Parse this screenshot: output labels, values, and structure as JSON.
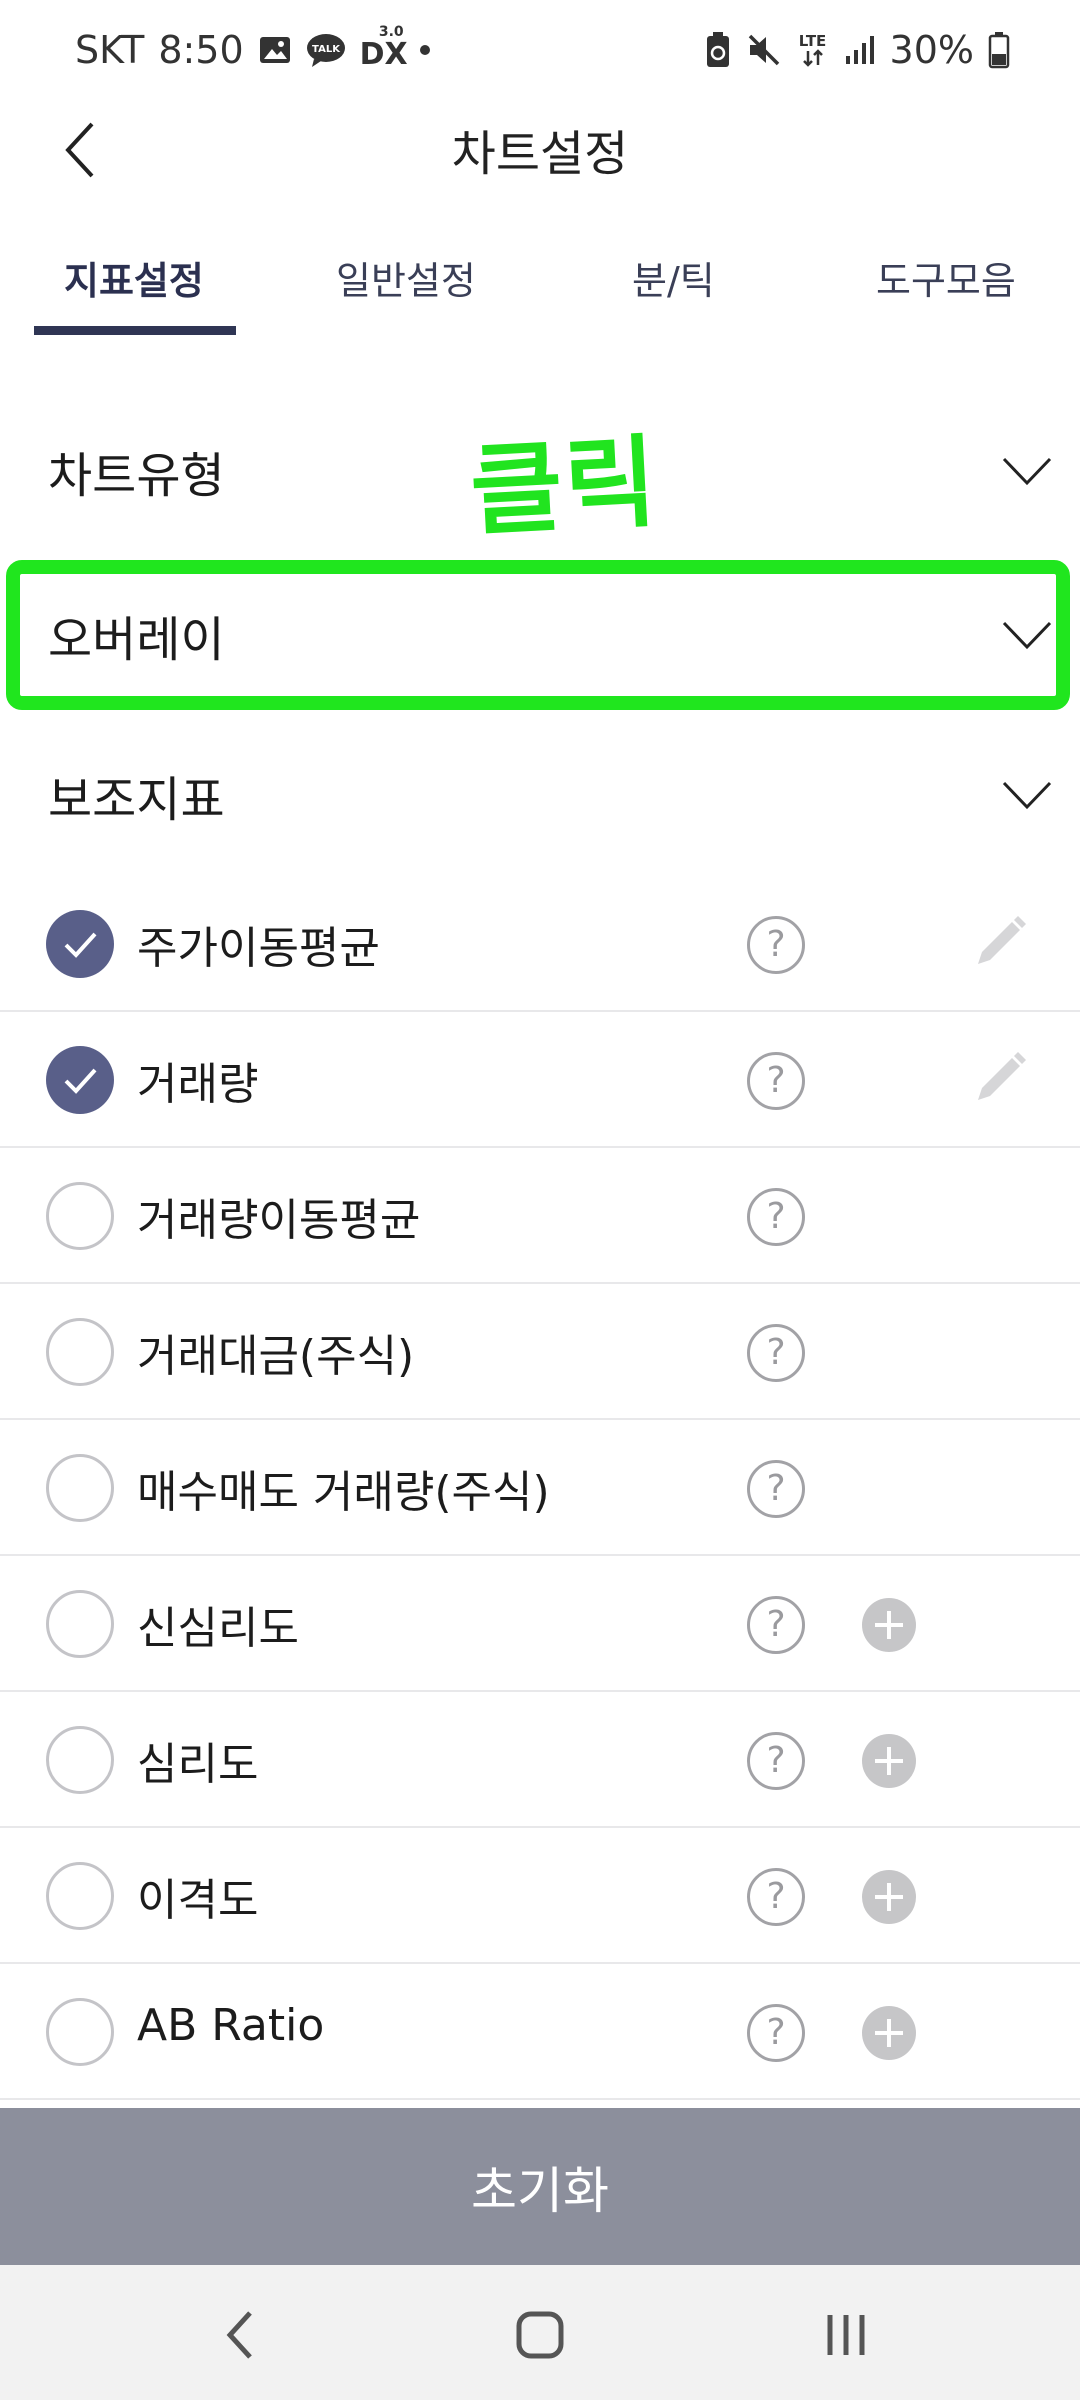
{
  "status_bar": {
    "carrier": "SKT",
    "time": "8:50",
    "dx_label": "DX",
    "dx_version": "3.0",
    "talk_label": "TALK",
    "network": "LTE",
    "battery": "30%",
    "icons": [
      "gallery-icon",
      "kakaotalk-icon",
      "dx-icon",
      "dot-icon",
      "battery-saver-icon",
      "mute-icon",
      "lte-icon",
      "signal-icon",
      "battery-icon"
    ]
  },
  "header": {
    "title": "차트설정",
    "back_icon": "back-arrow-icon"
  },
  "tabs": [
    {
      "label": "지표설정",
      "active": true
    },
    {
      "label": "일반설정",
      "active": false
    },
    {
      "label": "분/틱",
      "active": false
    },
    {
      "label": "도구모음",
      "active": false
    }
  ],
  "sections": [
    {
      "label": "차트유형",
      "icon": "chevron-down-icon"
    },
    {
      "label": "오버레이",
      "icon": "chevron-down-icon"
    },
    {
      "label": "보조지표",
      "icon": "chevron-down-icon"
    }
  ],
  "annotation": {
    "text": "클릭",
    "color": "#21e41f"
  },
  "indicators": [
    {
      "label": "주가이동평균",
      "checked": true,
      "action": "edit"
    },
    {
      "label": "거래량",
      "checked": true,
      "action": "edit"
    },
    {
      "label": "거래량이동평균",
      "checked": false,
      "action": "none"
    },
    {
      "label": "거래대금(주식)",
      "checked": false,
      "action": "none"
    },
    {
      "label": "매수매도 거래량(주식)",
      "checked": false,
      "action": "none"
    },
    {
      "label": "신심리도",
      "checked": false,
      "action": "add"
    },
    {
      "label": "심리도",
      "checked": false,
      "action": "add"
    },
    {
      "label": "이격도",
      "checked": false,
      "action": "add"
    },
    {
      "label": "AB Ratio",
      "checked": false,
      "action": "add"
    }
  ],
  "help_symbol": "?",
  "reset_button": {
    "label": "초기화"
  },
  "colors": {
    "accent": "#595f89",
    "tab_indicator": "#2f3554",
    "reset_bg": "#8c8f9c",
    "highlight": "#20e61e"
  },
  "nav_bar": {
    "buttons": [
      "nav-back-icon",
      "nav-home-icon",
      "nav-recents-icon"
    ]
  }
}
